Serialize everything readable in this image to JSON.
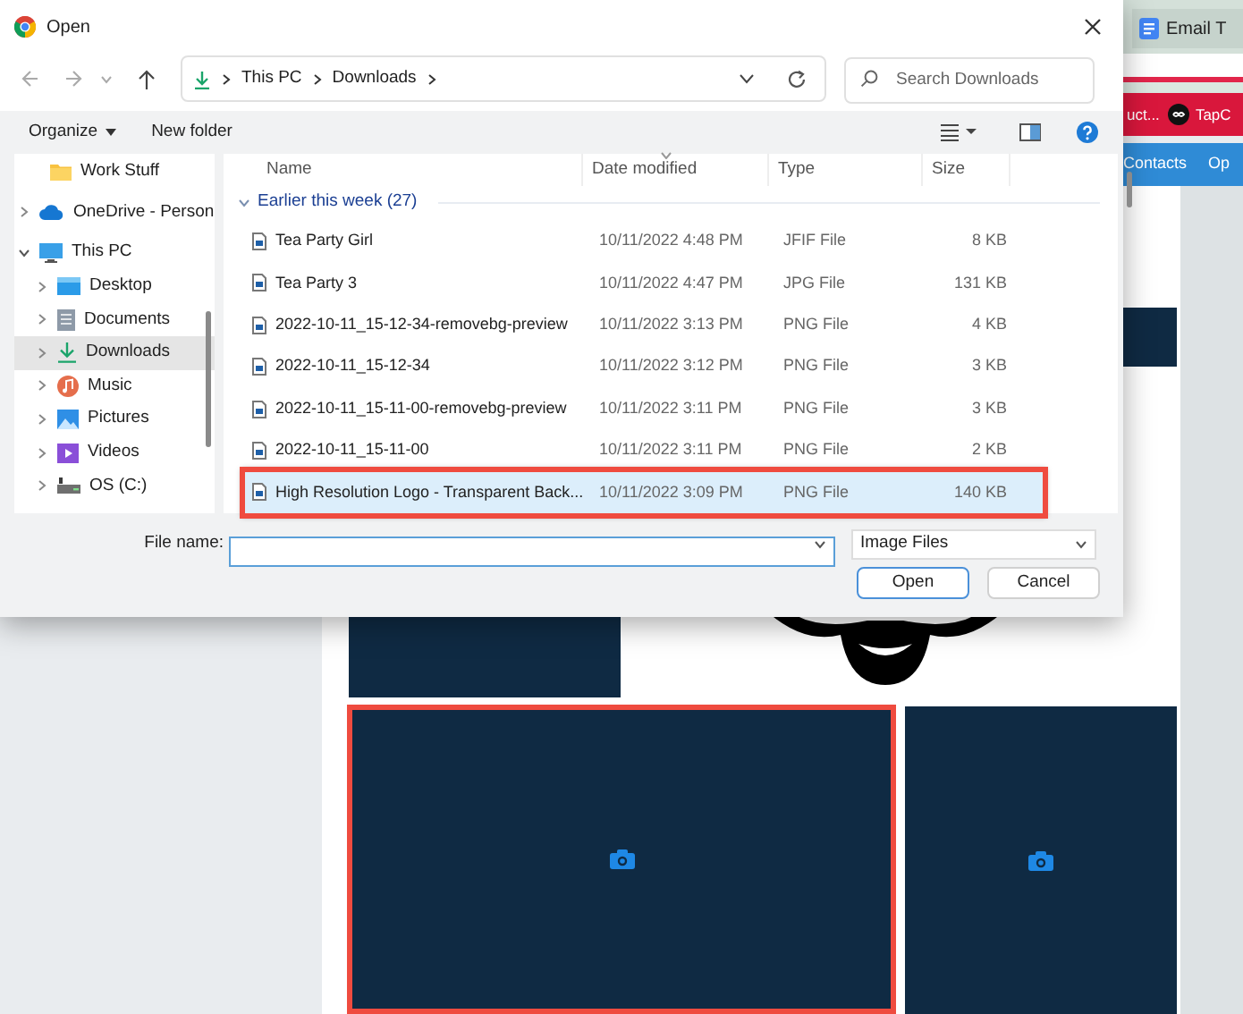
{
  "background_page": {
    "tabs": [
      {
        "label": "Email T",
        "selected": false
      }
    ],
    "menu_bar": [
      {
        "label": "uct...",
        "kind": "text"
      },
      {
        "label": "TapC",
        "kind": "logo"
      }
    ],
    "nav_bar": [
      "Contacts",
      "Op"
    ],
    "panels": [
      {
        "kind": "plain",
        "annotated": false
      },
      {
        "kind": "camera",
        "annotated": true
      },
      {
        "kind": "camera",
        "annotated": false
      }
    ]
  },
  "dialog": {
    "title": "Open",
    "address": [
      "This PC",
      "Downloads"
    ],
    "search": {
      "placeholder": "Search Downloads"
    },
    "toolbar": [
      "Organize",
      "New folder"
    ],
    "nav": [
      {
        "label": "Work Stuff",
        "kind": "folder"
      },
      {
        "label": "OneDrive - Person",
        "kind": "cloud",
        "expanded": false,
        "selected": false
      },
      {
        "label": "This PC",
        "kind": "pc",
        "expanded": true,
        "selected": false,
        "children": [
          {
            "label": "Desktop",
            "kind": "desktop",
            "expanded": false,
            "selected": false
          },
          {
            "label": "Documents",
            "kind": "documents",
            "expanded": false,
            "selected": false
          },
          {
            "label": "Downloads",
            "kind": "downloads",
            "expanded": false,
            "selected": true
          },
          {
            "label": "Music",
            "kind": "music",
            "expanded": false,
            "selected": false
          },
          {
            "label": "Pictures",
            "kind": "pictures",
            "expanded": false,
            "selected": false
          },
          {
            "label": "Videos",
            "kind": "videos",
            "expanded": false,
            "selected": false
          },
          {
            "label": "OS (C:)",
            "kind": "drive",
            "expanded": false,
            "selected": false
          }
        ]
      }
    ],
    "columns": [
      "Name",
      "Date modified",
      "Type",
      "Size"
    ],
    "group": {
      "label": "Earlier this week (27)",
      "expanded": true
    },
    "rows": [
      {
        "name": "Tea Party Girl",
        "date": "10/11/2022 4:48 PM",
        "type": "JFIF File",
        "size": "8 KB",
        "selected": false,
        "annotated": false
      },
      {
        "name": "Tea Party 3",
        "date": "10/11/2022 4:47 PM",
        "type": "JPG File",
        "size": "131 KB",
        "selected": false,
        "annotated": false
      },
      {
        "name": "2022-10-11_15-12-34-removebg-preview",
        "date": "10/11/2022 3:13 PM",
        "type": "PNG File",
        "size": "4 KB",
        "selected": false,
        "annotated": false
      },
      {
        "name": "2022-10-11_15-12-34",
        "date": "10/11/2022 3:12 PM",
        "type": "PNG File",
        "size": "3 KB",
        "selected": false,
        "annotated": false
      },
      {
        "name": "2022-10-11_15-11-00-removebg-preview",
        "date": "10/11/2022 3:11 PM",
        "type": "PNG File",
        "size": "3 KB",
        "selected": false,
        "annotated": false
      },
      {
        "name": "2022-10-11_15-11-00",
        "date": "10/11/2022 3:11 PM",
        "type": "PNG File",
        "size": "2 KB",
        "selected": false,
        "annotated": false
      },
      {
        "name": "High Resolution Logo - Transparent Back...",
        "date": "10/11/2022 3:09 PM",
        "type": "PNG File",
        "size": "140 KB",
        "selected": true,
        "annotated": true
      }
    ],
    "file_name_label": "File name:",
    "filter": "Image Files",
    "buttons": [
      {
        "label": "Open",
        "default": true
      },
      {
        "label": "Cancel",
        "default": false
      }
    ]
  }
}
